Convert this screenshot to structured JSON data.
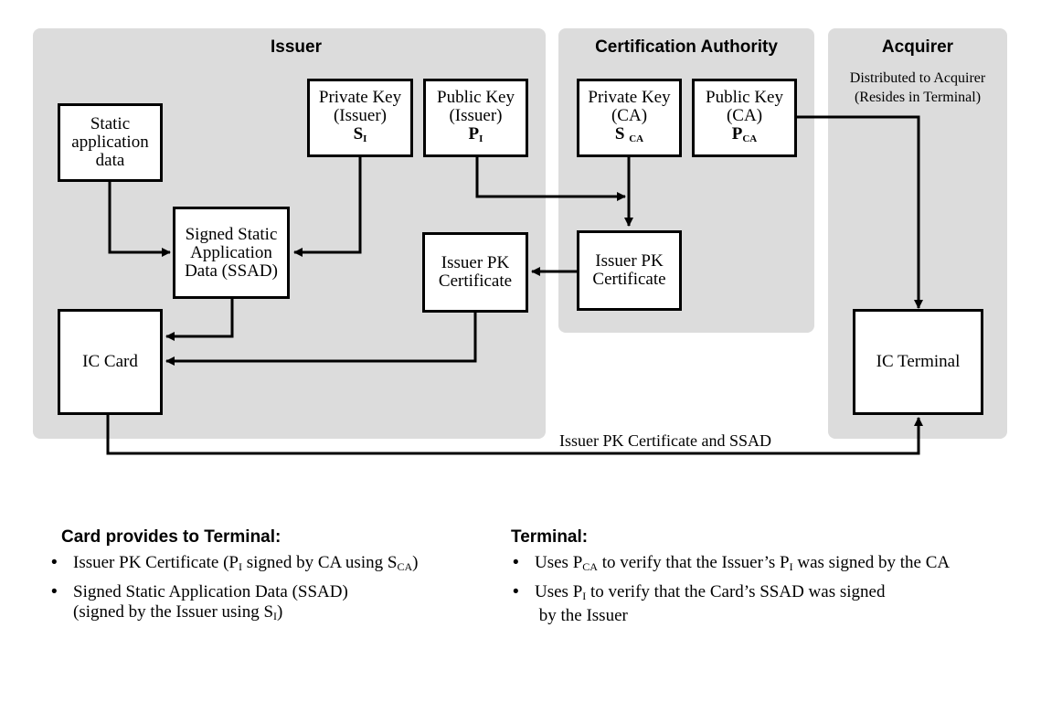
{
  "regions": {
    "issuer": {
      "title": "Issuer"
    },
    "ca": {
      "title": "Certification Authority"
    },
    "acquirer": {
      "title": "Acquirer",
      "note_line1": "Distributed to Acquirer",
      "note_line2": "(Resides in Terminal)"
    }
  },
  "nodes": {
    "static_data": {
      "line1": "Static",
      "line2": "application",
      "line3": "data"
    },
    "issuer_private_key": {
      "line1": "Private Key",
      "line2": "(Issuer)",
      "symbol": "S",
      "symbol_sub": "I"
    },
    "issuer_public_key": {
      "line1": "Public Key",
      "line2": "(Issuer)",
      "symbol": "P",
      "symbol_sub": "I"
    },
    "ca_private_key": {
      "line1": "Private Key",
      "line2": "(CA)",
      "symbol": "S",
      "symbol_sub": "CA"
    },
    "ca_public_key": {
      "line1": "Public Key",
      "line2": "(CA)",
      "symbol": "P",
      "symbol_sub": "CA"
    },
    "ssad": {
      "line1": "Signed Static",
      "line2": "Application",
      "line3": "Data (SSAD)"
    },
    "issuer_cert_issuer": {
      "line1": "Issuer PK",
      "line2": "Certificate"
    },
    "issuer_cert_ca": {
      "line1": "Issuer PK",
      "line2": "Certificate"
    },
    "ic_card": {
      "label": "IC Card"
    },
    "ic_terminal": {
      "label": "IC Terminal"
    }
  },
  "flows": {
    "card_to_terminal_label": "Issuer PK Certificate and SSAD"
  },
  "edges": [
    {
      "from": "static_data",
      "to": "ssad"
    },
    {
      "from": "issuer_private_key",
      "to": "ssad"
    },
    {
      "from": "issuer_public_key",
      "to": "issuer_cert_ca"
    },
    {
      "from": "ca_private_key",
      "to": "issuer_cert_ca"
    },
    {
      "from": "issuer_cert_ca",
      "to": "issuer_cert_issuer"
    },
    {
      "from": "ssad",
      "to": "ic_card"
    },
    {
      "from": "issuer_cert_issuer",
      "to": "ic_card"
    },
    {
      "from": "ca_public_key",
      "to": "ic_terminal"
    },
    {
      "from": "ic_card",
      "to": "ic_terminal",
      "label": "Issuer PK Certificate and SSAD"
    }
  ],
  "legend": {
    "card": {
      "title": "Card provides to Terminal:",
      "item1_a": "Issuer PK Certificate (P",
      "item1_sub1": "I",
      "item1_b": " signed by CA using S",
      "item1_sub2": "CA",
      "item1_c": ")",
      "item2_line1": "Signed Static Application Data (SSAD)",
      "item2_a": "(signed by the Issuer using S",
      "item2_sub": "I",
      "item2_c": ")"
    },
    "terminal": {
      "title": "Terminal:",
      "item1_a": "Uses P",
      "item1_sub1": "CA",
      "item1_b": " to verify that the Issuer’s P",
      "item1_sub2": "I",
      "item1_c": "  was signed by the CA",
      "item2_a": "Uses  P",
      "item2_sub": "I",
      "item2_b": "  to verify that the Card’s SSAD was signed",
      "item2_line2": " by the Issuer"
    }
  }
}
